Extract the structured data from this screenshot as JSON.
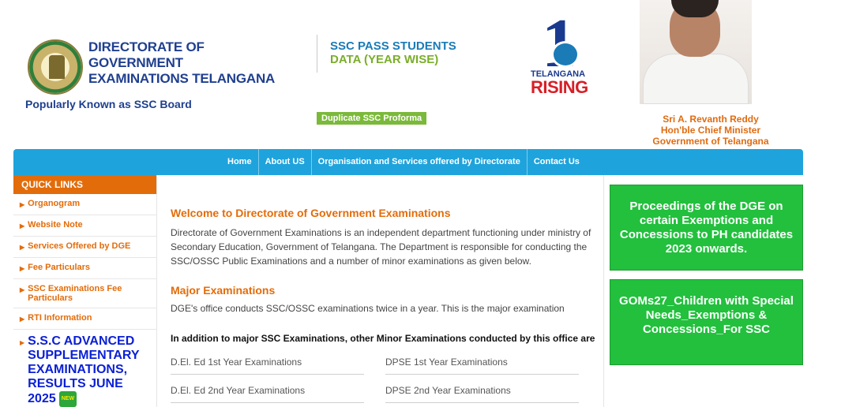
{
  "header": {
    "org_title": "DIRECTORATE OF GOVERNMENT EXAMINATIONS TELANGANA",
    "org_subtitle": "Popularly Known as SSC Board",
    "ssc_line1": "SSC PASS STUDENTS",
    "ssc_line2": "DATA (YEAR WISE)",
    "duplicate_button": "Duplicate SSC Proforma",
    "rising_line1": "TELANGANA",
    "rising_line2": "RISING",
    "cm_name": "Sri A. Revanth Reddy",
    "cm_title": "Hon'ble Chief Minister",
    "cm_govt": "Government of Telangana"
  },
  "nav": {
    "items": [
      "Home",
      "About US",
      "Organisation and Services offered by Directorate",
      "Contact Us"
    ]
  },
  "sidebar": {
    "heading": "QUICK LINKS",
    "items": [
      "Organogram",
      "Website Note",
      "Services Offered by DGE",
      "Fee Particulars",
      "SSC Examinations Fee Particulars",
      "RTI Information"
    ],
    "highlight": "S.S.C ADVANCED SUPPLEMENTARY EXAMINATIONS, RESULTS JUNE 2025",
    "new_badge": "NEW"
  },
  "main": {
    "welcome_heading": "Welcome to Directorate of Government Examinations",
    "welcome_text": "Directorate of Government Examinations is an independent department functioning under ministry of Secondary Education, Government of Telangana. The Department is responsible for conducting the SSC/OSSC Public Examinations and a number of minor examinations as given below.",
    "major_heading": "Major Examinations",
    "major_text": "DGE's office conducts SSC/OSSC examinations twice in a year. This is the major examination",
    "minor_text": "In addition to major SSC Examinations, other Minor Examinations conducted by this office are",
    "exams": [
      "D.El. Ed 1st Year Examinations",
      "DPSE 1st Year Examinations",
      "D.El. Ed 2nd Year Examinations",
      "DPSE 2nd Year Examinations"
    ]
  },
  "notices": [
    "Proceedings of the DGE on certain Exemptions and Concessions to PH candidates 2023 onwards.",
    "GOMs27_Children with Special Needs_Exemptions & Concessions_For SSC"
  ],
  "colors": {
    "nav": "#1fa3dc",
    "accent_orange": "#e36c0a",
    "notice_green": "#22c03d",
    "title_blue": "#1f3f8f"
  }
}
